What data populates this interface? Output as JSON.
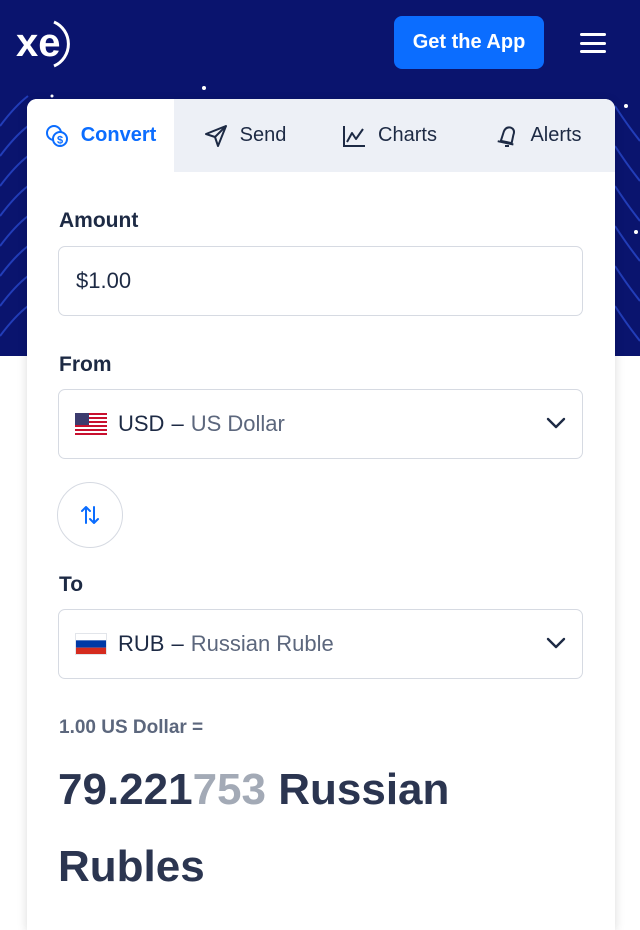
{
  "header": {
    "logo_text": "xe",
    "get_app_label": "Get the App",
    "menu_icon": "hamburger-icon"
  },
  "tabs": [
    {
      "label": "Convert",
      "icon": "coins-icon",
      "active": true
    },
    {
      "label": "Send",
      "icon": "paper-plane-icon",
      "active": false
    },
    {
      "label": "Charts",
      "icon": "line-chart-icon",
      "active": false
    },
    {
      "label": "Alerts",
      "icon": "bell-icon",
      "active": false
    }
  ],
  "amount": {
    "label": "Amount",
    "value": "$1.00"
  },
  "from": {
    "label": "From",
    "code": "USD",
    "separator": "–",
    "name": "US Dollar",
    "flag_icon": "us-flag-icon"
  },
  "to": {
    "label": "To",
    "code": "RUB",
    "separator": "–",
    "name": "Russian Ruble",
    "flag_icon": "russia-flag-icon"
  },
  "swap_icon": "swap-arrows-icon",
  "result": {
    "base_line": "1.00 US Dollar =",
    "value_main": "79.221",
    "value_faded": "753",
    "currency": " Russian Rubles"
  },
  "colors": {
    "brand_navy": "#0a146e",
    "accent_blue": "#0b6dff",
    "text_dark": "#1d2a44",
    "text_muted": "#5c677d",
    "faded_digits": "#a3aab6"
  }
}
